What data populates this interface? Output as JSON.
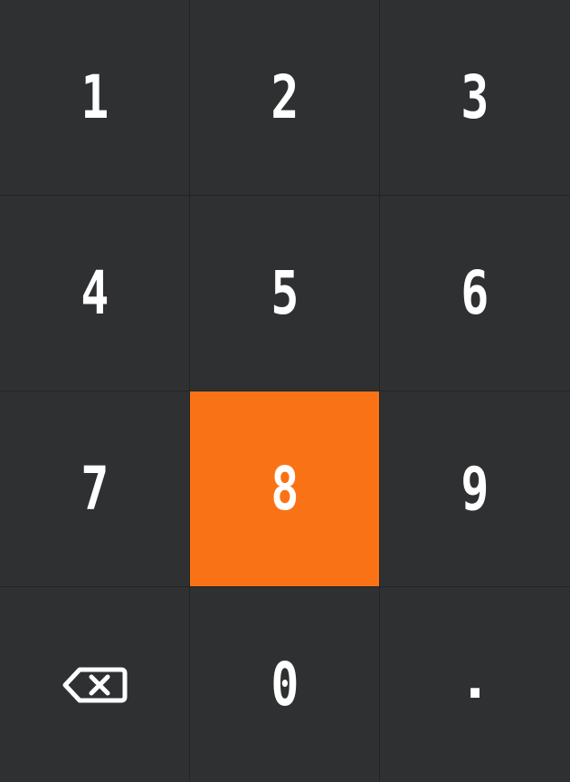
{
  "keypad": {
    "accent_color": "#f97316",
    "key_color": "#2f3032",
    "active_key": "8",
    "keys": [
      {
        "id": "1",
        "label": "1"
      },
      {
        "id": "2",
        "label": "2"
      },
      {
        "id": "3",
        "label": "3"
      },
      {
        "id": "4",
        "label": "4"
      },
      {
        "id": "5",
        "label": "5"
      },
      {
        "id": "6",
        "label": "6"
      },
      {
        "id": "7",
        "label": "7"
      },
      {
        "id": "8",
        "label": "8"
      },
      {
        "id": "9",
        "label": "9"
      },
      {
        "id": "backspace",
        "icon": "backspace-icon"
      },
      {
        "id": "0",
        "label": "0"
      },
      {
        "id": "dot",
        "label": "."
      }
    ]
  }
}
